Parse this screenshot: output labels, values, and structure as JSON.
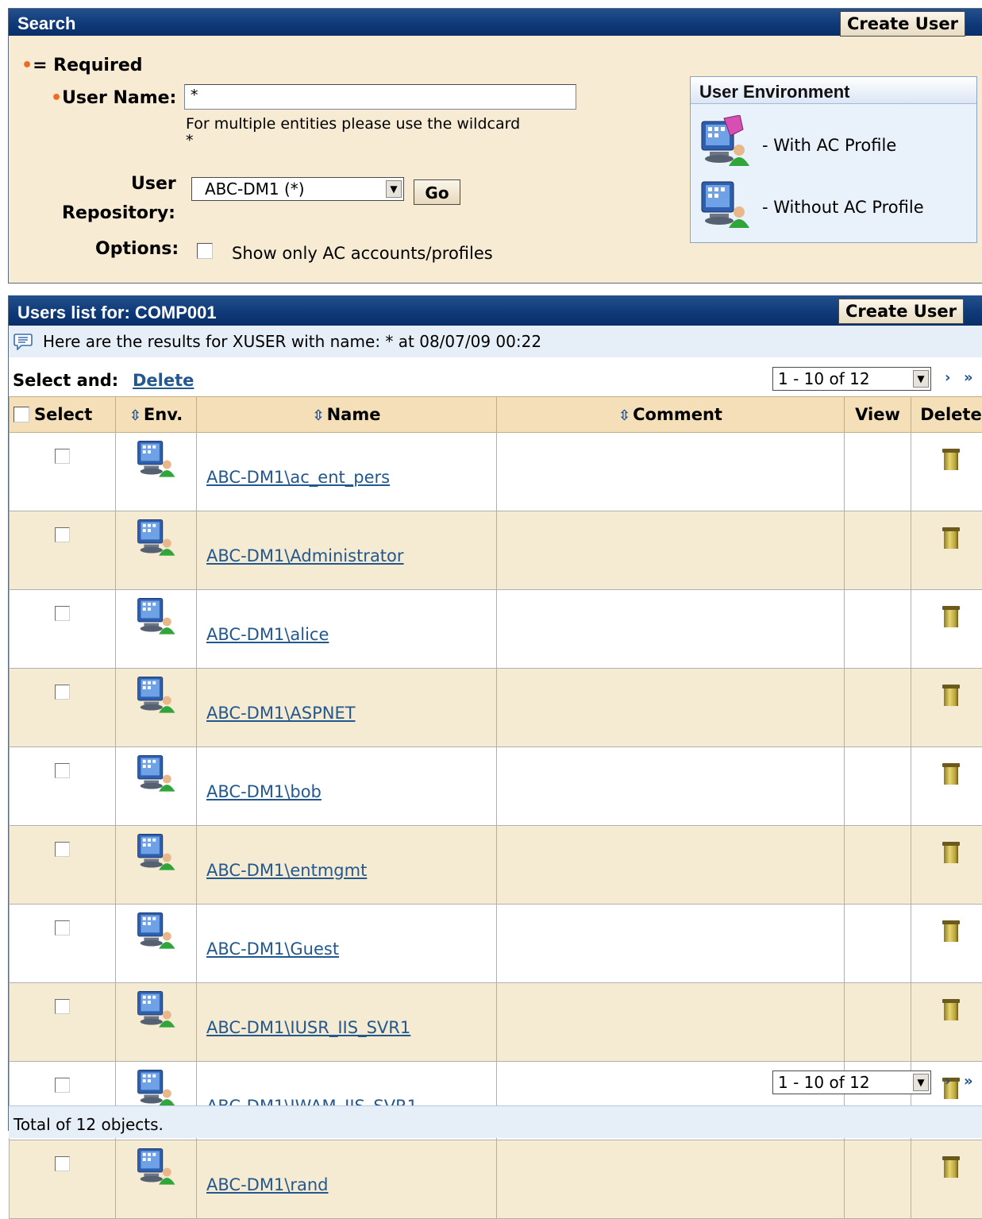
{
  "search": {
    "title": "Search",
    "create_user": "Create User",
    "required_legend": "= Required",
    "username_label": "User Name:",
    "username_value": "*",
    "wildcard_hint_1": "For multiple entities please use the wildcard",
    "wildcard_hint_2": "*",
    "repository_label_1": "User",
    "repository_label_2": "Repository:",
    "repository_value": "ABC-DM1 (*)",
    "go_label": "Go",
    "options_label": "Options:",
    "options_checkbox_label": "Show only AC accounts/profiles"
  },
  "env_legend": {
    "title": "User Environment",
    "with_profile": "- With AC Profile",
    "without_profile": "- Without AC Profile"
  },
  "users_list": {
    "title": "Users list for: COMP001",
    "create_user": "Create User",
    "results_message": "Here are the results for XUSER with name: * at 08/07/09 00:22",
    "select_and": "Select and:",
    "delete_action": "Delete",
    "pager_value": "1 - 10 of 12",
    "columns": {
      "select": "Select",
      "env": "Env.",
      "name": "Name",
      "comment": "Comment",
      "view": "View",
      "delete": "Delete"
    },
    "rows": [
      {
        "name": "ABC-DM1\\ac_ent_pers",
        "comment": ""
      },
      {
        "name": "ABC-DM1\\Administrator",
        "comment": ""
      },
      {
        "name": "ABC-DM1\\alice",
        "comment": ""
      },
      {
        "name": "ABC-DM1\\ASPNET",
        "comment": ""
      },
      {
        "name": "ABC-DM1\\bob",
        "comment": ""
      },
      {
        "name": "ABC-DM1\\entmgmt",
        "comment": ""
      },
      {
        "name": "ABC-DM1\\Guest",
        "comment": ""
      },
      {
        "name": "ABC-DM1\\IUSR_IIS_SVR1",
        "comment": ""
      },
      {
        "name": "ABC-DM1\\IWAM_IIS_SVR1",
        "comment": ""
      },
      {
        "name": "ABC-DM1\\rand",
        "comment": ""
      }
    ],
    "total": "Total of 12 objects."
  }
}
